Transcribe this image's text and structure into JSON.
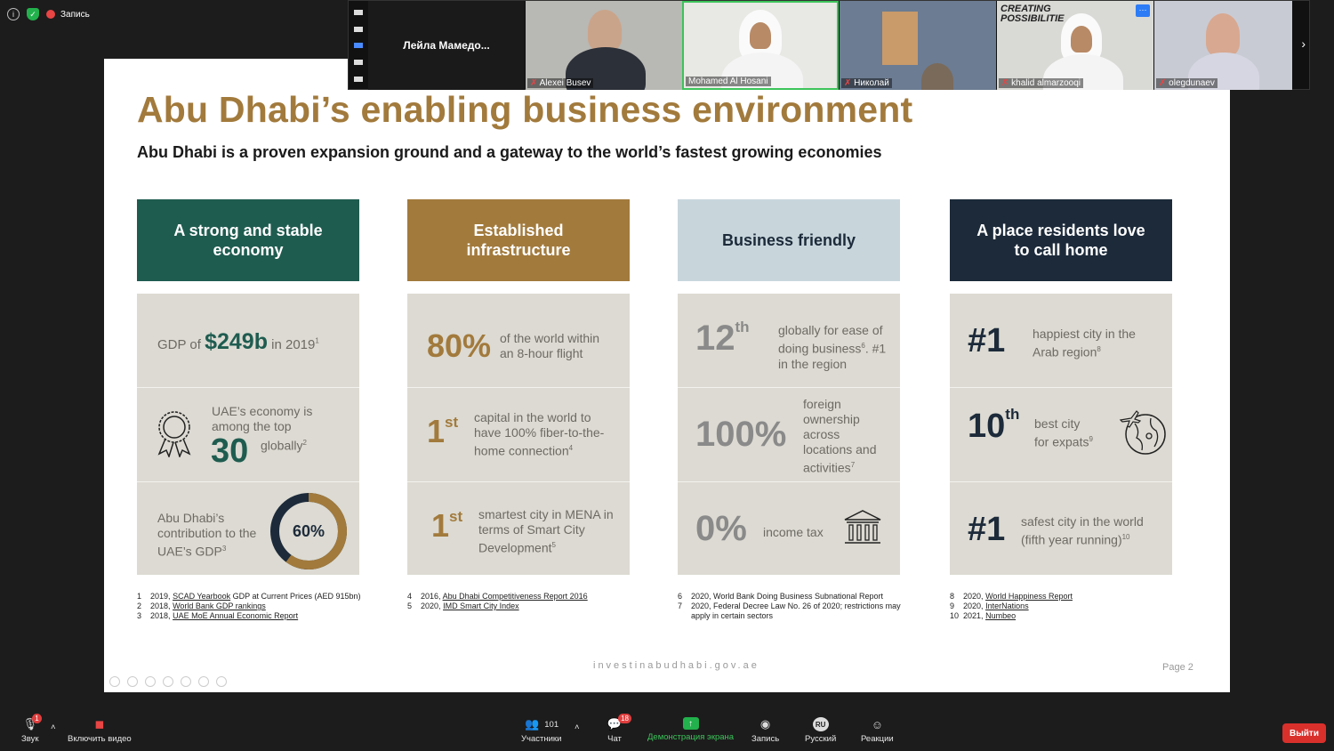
{
  "status": {
    "record_label": "Запись"
  },
  "strip": {
    "name_only_tile": "Лейла  Мамедо...",
    "participants": [
      {
        "name": "Alexei Busev"
      },
      {
        "name": "Mohamed Al Hosani"
      },
      {
        "name": "Николай"
      },
      {
        "name": "khalid almarzooqi"
      },
      {
        "name": "olegdunaev"
      }
    ],
    "banner_text": "CREATING POSSIBILITIE"
  },
  "slide": {
    "title": "Abu Dhabi’s enabling business environment",
    "subtitle": "Abu Dhabi is a proven expansion ground and a gateway to the world’s fastest growing economies",
    "colors": {
      "green": "#1f5c50",
      "gold": "#a27a3c",
      "lightblue": "#c8d6dc",
      "navy": "#1c2a3a"
    },
    "col1": {
      "header": "A strong and stable economy",
      "c1": {
        "pre": "GDP of ",
        "value": "$249b",
        "post": " in 2019",
        "sup": "1"
      },
      "c2": {
        "text1": "UAE’s economy is among the top",
        "value": "30",
        "text2": "globally",
        "sup": "2"
      },
      "c3": {
        "text": "Abu Dhabi’s contribution to the UAE’s GDP",
        "sup": "3",
        "value": "60%",
        "fraction": 0.6
      },
      "footnotes": [
        {
          "n": "1",
          "year": "2019,",
          "link": "SCAD Yearbook",
          "rest": " GDP at Current Prices (AED 915bn)"
        },
        {
          "n": "2",
          "year": "2018,",
          "link": "World Bank GDP rankings",
          "rest": ""
        },
        {
          "n": "3",
          "year": "2018,",
          "link": "UAE MoE Annual Economic Report",
          "rest": ""
        }
      ]
    },
    "col2": {
      "header": "Established infrastructure",
      "c1": {
        "value": "80%",
        "text": "of the world within an 8-hour flight"
      },
      "c2": {
        "value": "1",
        "sup_ord": "st",
        "text": "capital in the world to have 100% fiber-to-the-home connection",
        "sup": "4"
      },
      "c3": {
        "value": "1",
        "sup_ord": "st",
        "text": "smartest city in MENA in terms of Smart City Development",
        "sup": "5"
      },
      "footnotes": [
        {
          "n": "4",
          "year": "2016,",
          "link": "Abu Dhabi Competitiveness Report 2016",
          "rest": ""
        },
        {
          "n": "5",
          "year": "2020,",
          "link": "IMD Smart City Index",
          "rest": ""
        }
      ]
    },
    "col3": {
      "header": "Business friendly",
      "c1": {
        "value": "12",
        "sup_ord": "th",
        "text": "globally for ease of doing business",
        "sup": "6",
        "text2": ". #1 in the region"
      },
      "c2": {
        "value": "100%",
        "text": "foreign ownership across locations and activities",
        "sup": "7"
      },
      "c3": {
        "value": "0%",
        "text": "income tax"
      },
      "footnotes": [
        {
          "n": "6",
          "text": "2020, World Bank Doing Business Subnational Report"
        },
        {
          "n": "7",
          "text": "2020, Federal Decree Law No. 26 of 2020; restrictions may"
        },
        {
          "n": "",
          "text": "apply in certain sectors"
        }
      ]
    },
    "col4": {
      "header": "A place residents love to call home",
      "c1": {
        "value": "#1",
        "text": "happiest city in the Arab region",
        "sup": "8"
      },
      "c2": {
        "value": "10",
        "sup_ord": "th",
        "text1": "best city",
        "text2": "for expats",
        "sup": "9"
      },
      "c3": {
        "value": "#1",
        "text1": "safest city in the world",
        "text2": "(fifth year running)",
        "sup": "10"
      },
      "footnotes": [
        {
          "n": "8",
          "year": "2020,",
          "link": "World Happiness Report"
        },
        {
          "n": "9",
          "year": "2020,",
          "link": "InterNations"
        },
        {
          "n": "10",
          "year": "2021,",
          "link": "Numbeo"
        }
      ]
    },
    "website": "investinabudhabi.gov.ae",
    "page": "Page  2"
  },
  "toolbar": {
    "sound": "Звук",
    "video": "Включить видео",
    "participants": "Участники",
    "participants_count": "101",
    "chat": "Чат",
    "chat_badge": "18",
    "share": "Демонстрация экрана",
    "record": "Запись",
    "language": "Русский",
    "language_code": "RU",
    "reactions": "Реакции",
    "exit": "Выйти",
    "mic_badge": "1"
  }
}
